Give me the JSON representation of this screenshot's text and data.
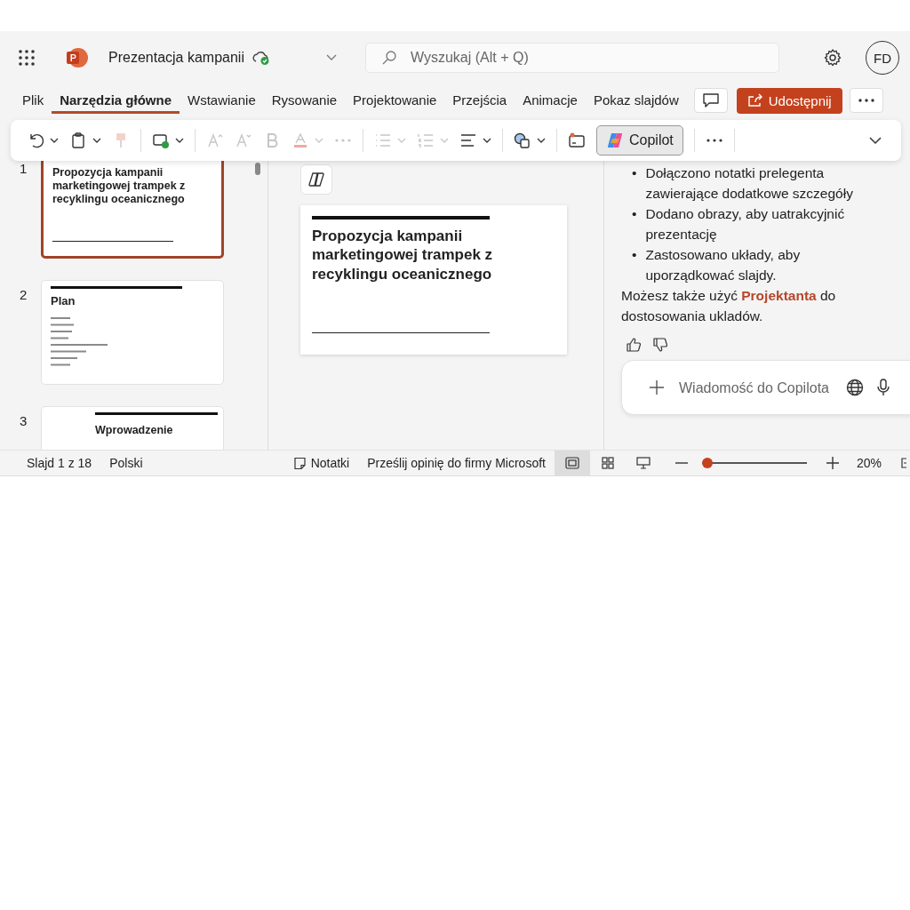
{
  "title_bar": {
    "document_title": "Prezentacja kampanii",
    "saved": true,
    "search_placeholder": "Wyszukaj (Alt + Q)",
    "avatar": "FD"
  },
  "ribbon_tabs": [
    {
      "label": "Plik",
      "selected": false
    },
    {
      "label": "Narzędzia główne",
      "selected": true
    },
    {
      "label": "Wstawianie",
      "selected": false
    },
    {
      "label": "Rysowanie",
      "selected": false
    },
    {
      "label": "Projektowanie",
      "selected": false
    },
    {
      "label": "Przejścia",
      "selected": false
    },
    {
      "label": "Animacje",
      "selected": false
    },
    {
      "label": "Pokaz slajdów",
      "selected": false
    }
  ],
  "share_button": "Udostępnij",
  "toolbar": [
    {
      "kind": "undo",
      "disabled": false,
      "dropdown": true
    },
    {
      "kind": "paste",
      "disabled": false,
      "dropdown": true
    },
    {
      "kind": "painter",
      "disabled": true,
      "dropdown": false
    },
    {
      "kind": "separator"
    },
    {
      "kind": "new-slide",
      "disabled": false,
      "dropdown": true
    },
    {
      "kind": "separator"
    },
    {
      "kind": "grow-font",
      "disabled": true,
      "dropdown": false
    },
    {
      "kind": "shrink-font",
      "disabled": true,
      "dropdown": false
    },
    {
      "kind": "bold",
      "disabled": true,
      "dropdown": false
    },
    {
      "kind": "font-color",
      "disabled": true,
      "dropdown": true
    },
    {
      "kind": "more",
      "disabled": true,
      "dropdown": false
    },
    {
      "kind": "separator"
    },
    {
      "kind": "bullets",
      "disabled": true,
      "dropdown": true
    },
    {
      "kind": "numbering",
      "disabled": true,
      "dropdown": true
    },
    {
      "kind": "align",
      "disabled": false,
      "dropdown": true
    },
    {
      "kind": "separator"
    },
    {
      "kind": "shapes",
      "disabled": false,
      "dropdown": true
    },
    {
      "kind": "separator"
    },
    {
      "kind": "designer",
      "disabled": false,
      "dropdown": false
    },
    {
      "kind": "copilot",
      "label": "Copilot",
      "selected": true
    },
    {
      "kind": "separator"
    },
    {
      "kind": "more",
      "disabled": false,
      "dropdown": false
    },
    {
      "kind": "separator"
    }
  ],
  "slides": [
    {
      "number": "1",
      "title": "Propozycja kampanii marketingowej trampek z recyklingu oceanicznego",
      "kind": "title",
      "selected": true
    },
    {
      "number": "2",
      "title": "Plan",
      "kind": "list",
      "selected": false
    },
    {
      "number": "3",
      "title": "Wprowadzenie",
      "kind": "section",
      "selected": false
    }
  ],
  "editor": {
    "slide_title": "Propozycja kampanii marketingowej trampek z recyklingu oceanicznego"
  },
  "copilot_pane": {
    "bullets": [
      {
        "marker": "•",
        "text": "Dołączono notatki prelegenta zawierające dodatkowe szczegóły"
      },
      {
        "marker": "•",
        "text": "Dodano obrazy, aby uatrakcyjnić prezentację"
      },
      {
        "marker": "•",
        "text": "Zastosowano układy, aby uporządkować slajdy."
      }
    ],
    "paragraph": "Możesz także użyć **Projektanta** do dostosowania ukladów.",
    "input_placeholder": "Wiadomość do Copilota"
  },
  "status_bar": {
    "slide": "Slajd 1 z 18",
    "language": "Polski",
    "notes": "Notatki",
    "feedback": "Prześlij opinię do firmy Microsoft",
    "views": [
      {
        "kind": "normal",
        "selected": true
      },
      {
        "kind": "sorter",
        "selected": false
      },
      {
        "kind": "reading",
        "selected": false
      }
    ],
    "zoom": {
      "level": 0.05,
      "reading": "20%"
    }
  }
}
